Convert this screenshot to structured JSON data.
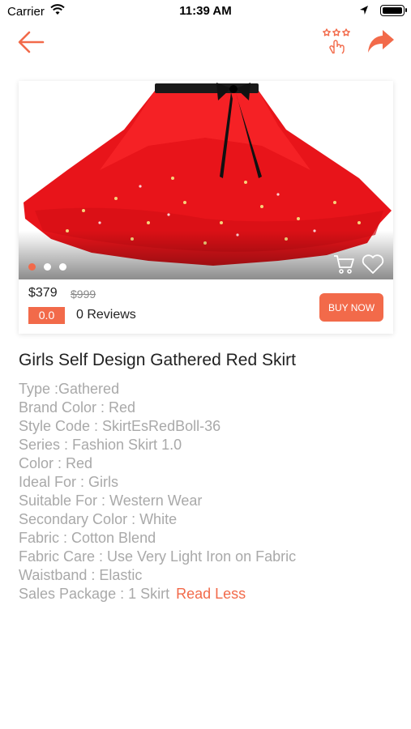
{
  "status_bar": {
    "carrier": "Carrier",
    "time": "11:39 AM"
  },
  "nav": {
    "icons": [
      "back-arrow-icon",
      "tap-rate-icon",
      "share-icon"
    ]
  },
  "product": {
    "price": "$379",
    "old_price": "$999",
    "rating": "0.0",
    "reviews": "0 Reviews",
    "buy_label": "BUY NOW",
    "carousel_dots": 3,
    "carousel_active_index": 0,
    "title": "Girls Self Design Gathered Red Skirt"
  },
  "specs": [
    "Type :Gathered",
    "Brand Color : Red",
    "Style Code : SkirtEsRedBoll-36",
    "Series : Fashion Skirt 1.0",
    "Color : Red",
    "Ideal For : Girls",
    "Suitable For : Western Wear",
    "Secondary Color : White",
    "Fabric : Cotton Blend",
    "Fabric Care : Use Very Light Iron on Fabric",
    "Waistband : Elastic",
    "Sales Package : 1 Skirt"
  ],
  "read_less_label": "Read Less",
  "colors": {
    "accent": "#f26a4a",
    "spec_text": "#a9a9a9",
    "title_text": "#222222"
  }
}
